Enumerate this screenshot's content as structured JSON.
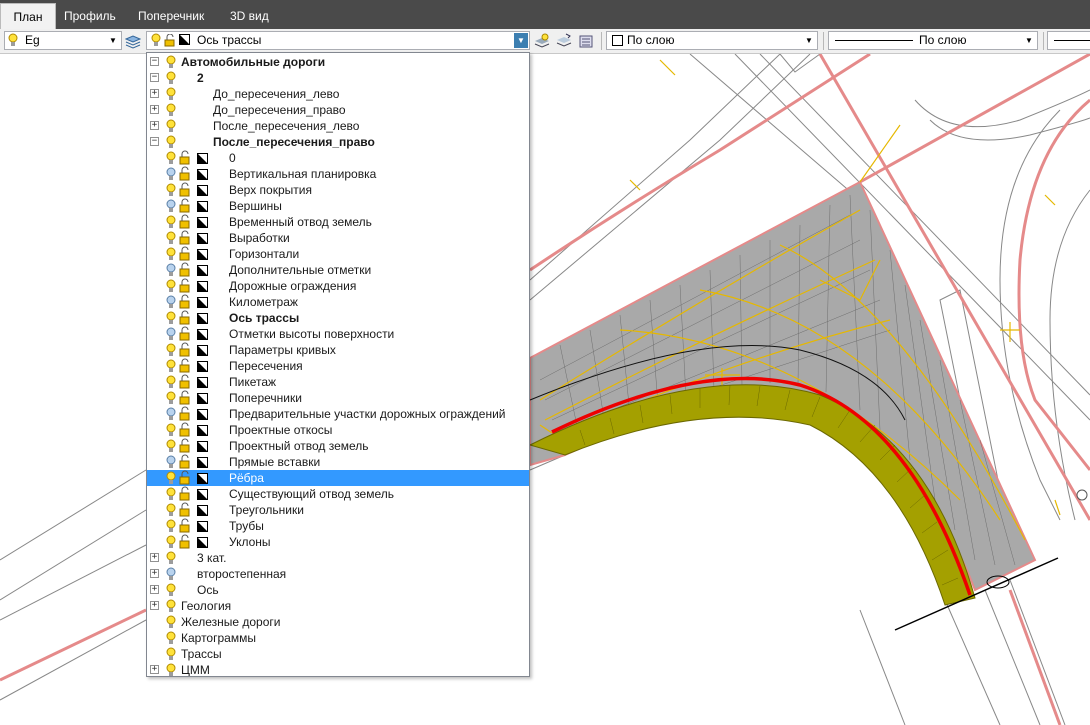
{
  "tabs": [
    {
      "label": "План",
      "active": true
    },
    {
      "label": "Профиль",
      "active": false
    },
    {
      "label": "Поперечник",
      "active": false
    },
    {
      "label": "3D вид",
      "active": false
    }
  ],
  "toolbar": {
    "layer_filter_value": "Eg",
    "current_layer_value": "Ось трассы",
    "color_value": "По слою",
    "linetype_value": "По слою"
  },
  "tree": [
    {
      "label": "Автомобильные дороги",
      "level": 0,
      "expander": "−",
      "bold": true,
      "icons": "bulb"
    },
    {
      "label": "2",
      "level": 1,
      "expander": "−",
      "bold": true,
      "icons": "bulb"
    },
    {
      "label": "До_пересечения_лево",
      "level": 2,
      "expander": "+",
      "bold": false,
      "icons": "bulb"
    },
    {
      "label": "До_пересечения_право",
      "level": 2,
      "expander": "+",
      "bold": false,
      "icons": "bulb"
    },
    {
      "label": "После_пересечения_лево",
      "level": 2,
      "expander": "+",
      "bold": false,
      "icons": "bulb"
    },
    {
      "label": "После_пересечения_право",
      "level": 2,
      "expander": "−",
      "bold": true,
      "icons": "bulb"
    },
    {
      "label": "0",
      "level": 3,
      "expander": "",
      "bold": false,
      "icons": "full-on"
    },
    {
      "label": "Вертикальная планировка",
      "level": 3,
      "expander": "",
      "bold": false,
      "icons": "full-off"
    },
    {
      "label": "Верх покрытия",
      "level": 3,
      "expander": "",
      "bold": false,
      "icons": "full-on"
    },
    {
      "label": "Вершины",
      "level": 3,
      "expander": "",
      "bold": false,
      "icons": "full-off"
    },
    {
      "label": "Временный отвод земель",
      "level": 3,
      "expander": "",
      "bold": false,
      "icons": "full-on"
    },
    {
      "label": "Выработки",
      "level": 3,
      "expander": "",
      "bold": false,
      "icons": "full-on"
    },
    {
      "label": "Горизонтали",
      "level": 3,
      "expander": "",
      "bold": false,
      "icons": "full-on"
    },
    {
      "label": "Дополнительные отметки",
      "level": 3,
      "expander": "",
      "bold": false,
      "icons": "full-off"
    },
    {
      "label": "Дорожные ограждения",
      "level": 3,
      "expander": "",
      "bold": false,
      "icons": "full-on"
    },
    {
      "label": "Километраж",
      "level": 3,
      "expander": "",
      "bold": false,
      "icons": "full-off"
    },
    {
      "label": "Ось трассы",
      "level": 3,
      "expander": "",
      "bold": true,
      "icons": "full-on"
    },
    {
      "label": "Отметки высоты поверхности",
      "level": 3,
      "expander": "",
      "bold": false,
      "icons": "full-off"
    },
    {
      "label": "Параметры кривых",
      "level": 3,
      "expander": "",
      "bold": false,
      "icons": "full-on"
    },
    {
      "label": "Пересечения",
      "level": 3,
      "expander": "",
      "bold": false,
      "icons": "full-on"
    },
    {
      "label": "Пикетаж",
      "level": 3,
      "expander": "",
      "bold": false,
      "icons": "full-on"
    },
    {
      "label": "Поперечники",
      "level": 3,
      "expander": "",
      "bold": false,
      "icons": "full-on"
    },
    {
      "label": "Предварительные участки дорожных ограждений",
      "level": 3,
      "expander": "",
      "bold": false,
      "icons": "full-off"
    },
    {
      "label": "Проектные откосы",
      "level": 3,
      "expander": "",
      "bold": false,
      "icons": "full-on"
    },
    {
      "label": "Проектный отвод земель",
      "level": 3,
      "expander": "",
      "bold": false,
      "icons": "full-on"
    },
    {
      "label": "Прямые вставки",
      "level": 3,
      "expander": "",
      "bold": false,
      "icons": "full-off"
    },
    {
      "label": "Рёбра",
      "level": 3,
      "expander": "",
      "bold": false,
      "icons": "full-on",
      "selected": true
    },
    {
      "label": "Существующий отвод земель",
      "level": 3,
      "expander": "",
      "bold": false,
      "icons": "full-on"
    },
    {
      "label": "Треугольники",
      "level": 3,
      "expander": "",
      "bold": false,
      "icons": "full-on"
    },
    {
      "label": "Трубы",
      "level": 3,
      "expander": "",
      "bold": false,
      "icons": "full-on"
    },
    {
      "label": "Уклоны",
      "level": 3,
      "expander": "",
      "bold": false,
      "icons": "full-on"
    },
    {
      "label": "3 кат.",
      "level": 1,
      "expander": "+",
      "bold": false,
      "icons": "bulb"
    },
    {
      "label": "второстепенная",
      "level": 1,
      "expander": "+",
      "bold": false,
      "icons": "bulb-off"
    },
    {
      "label": "Ось",
      "level": 1,
      "expander": "+",
      "bold": false,
      "icons": "bulb"
    },
    {
      "label": "Геология",
      "level": 0,
      "expander": "+",
      "bold": false,
      "icons": "bulb"
    },
    {
      "label": "Железные дороги",
      "level": 0,
      "expander": "",
      "bold": false,
      "icons": "bulb"
    },
    {
      "label": "Картограммы",
      "level": 0,
      "expander": "",
      "bold": false,
      "icons": "bulb"
    },
    {
      "label": "Трассы",
      "level": 0,
      "expander": "",
      "bold": false,
      "icons": "bulb"
    },
    {
      "label": "ЦММ",
      "level": 0,
      "expander": "+",
      "bold": false,
      "icons": "bulb"
    }
  ],
  "colors": {
    "tab_bar": "#4a4a4a",
    "selection": "#3399ff",
    "road_edge_pink": "#e58a8a",
    "axis_red": "#ee0000",
    "slope_olive": "#a4a000",
    "surface_gray": "#a9a9a9",
    "contour_yellow": "#e6b800"
  }
}
